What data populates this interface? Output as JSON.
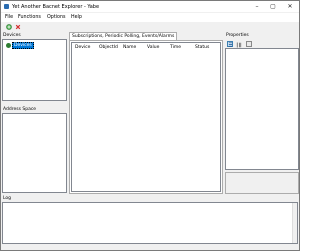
{
  "window": {
    "title": "Yet Another Bacnet Explorer - Yabe",
    "controls": [
      "–",
      "▢",
      "✕"
    ]
  },
  "menu": {
    "items": [
      "File",
      "Functions",
      "Options",
      "Help"
    ]
  },
  "toolbar": {
    "icons": [
      "add-device-icon",
      "remove-device-icon"
    ]
  },
  "devices": {
    "label": "Devices",
    "tree": [
      {
        "label": "Devices",
        "icon": "network-icon",
        "selected": true
      }
    ]
  },
  "address_space": {
    "label": "Address Space"
  },
  "subscriptions": {
    "tab_label": "Subscriptions, Periodic Polling, Events/Alarms",
    "columns": [
      "Device",
      "ObjectId",
      "Name",
      "Value",
      "Time",
      "Status"
    ]
  },
  "properties": {
    "label": "Properties",
    "buttons": [
      "categorized-icon",
      "alphabetical-icon",
      "property-pages-icon"
    ]
  },
  "log": {
    "label": "Log"
  },
  "colors": {
    "selection": "#0078d7",
    "panel_border": "#828790",
    "window_bg": "#f0f0f0"
  }
}
